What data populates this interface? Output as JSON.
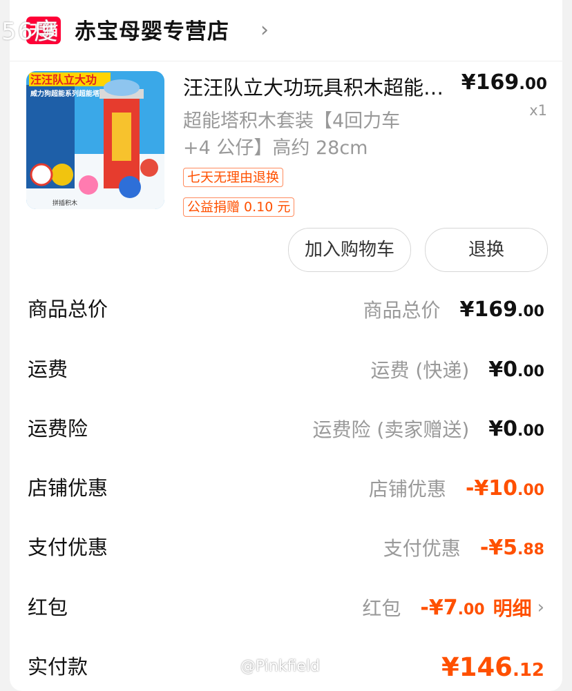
{
  "watermark_top": "56度",
  "shop": {
    "badge": "天猫",
    "name": "赤宝母婴专营店"
  },
  "product": {
    "title": "汪汪队立大功玩具积木超能塔积木套装",
    "spec_line1": "超能塔积木套装【4回力车",
    "spec_line2": "+4 公仔】高约 28cm",
    "price_int": "¥169",
    "price_dec": ".00",
    "qty": "x1",
    "tags": [
      "七天无理由退换",
      "公益捐赠 0.10 元"
    ],
    "image_texts": {
      "line1": "汪汪队立大功",
      "line2": "威力狗超能系列超能塔",
      "bottom": "拼插积木"
    }
  },
  "buttons": {
    "cart": "加入购物车",
    "refund": "退换"
  },
  "summary": [
    {
      "label": "商品总价",
      "sub": "商品总价",
      "amount_int": "¥169",
      "amount_dec": ".00",
      "negative": false
    },
    {
      "label": "运费",
      "sub": "运费 (快递)",
      "amount_int": "¥0",
      "amount_dec": ".00",
      "negative": false
    },
    {
      "label": "运费险",
      "sub": "运费险 (卖家赠送)",
      "amount_int": "¥0",
      "amount_dec": ".00",
      "negative": false
    },
    {
      "label": "店铺优惠",
      "sub": "店铺优惠",
      "amount_int": "-¥10",
      "amount_dec": ".00",
      "negative": true
    },
    {
      "label": "支付优惠",
      "sub": "支付优惠",
      "amount_int": "-¥5",
      "amount_dec": ".88",
      "negative": true
    },
    {
      "label": "红包",
      "sub": "红包",
      "amount_int": "-¥7",
      "amount_dec": ".00",
      "negative": true,
      "detail": "明细"
    }
  ],
  "total": {
    "label": "实付款",
    "amount_int": "¥146",
    "amount_dec": ".12"
  },
  "watermark_bottom": "@Pinkfield",
  "colors": {
    "accent": "#ff5000",
    "tmall": "#ff0036",
    "muted": "#999999"
  }
}
